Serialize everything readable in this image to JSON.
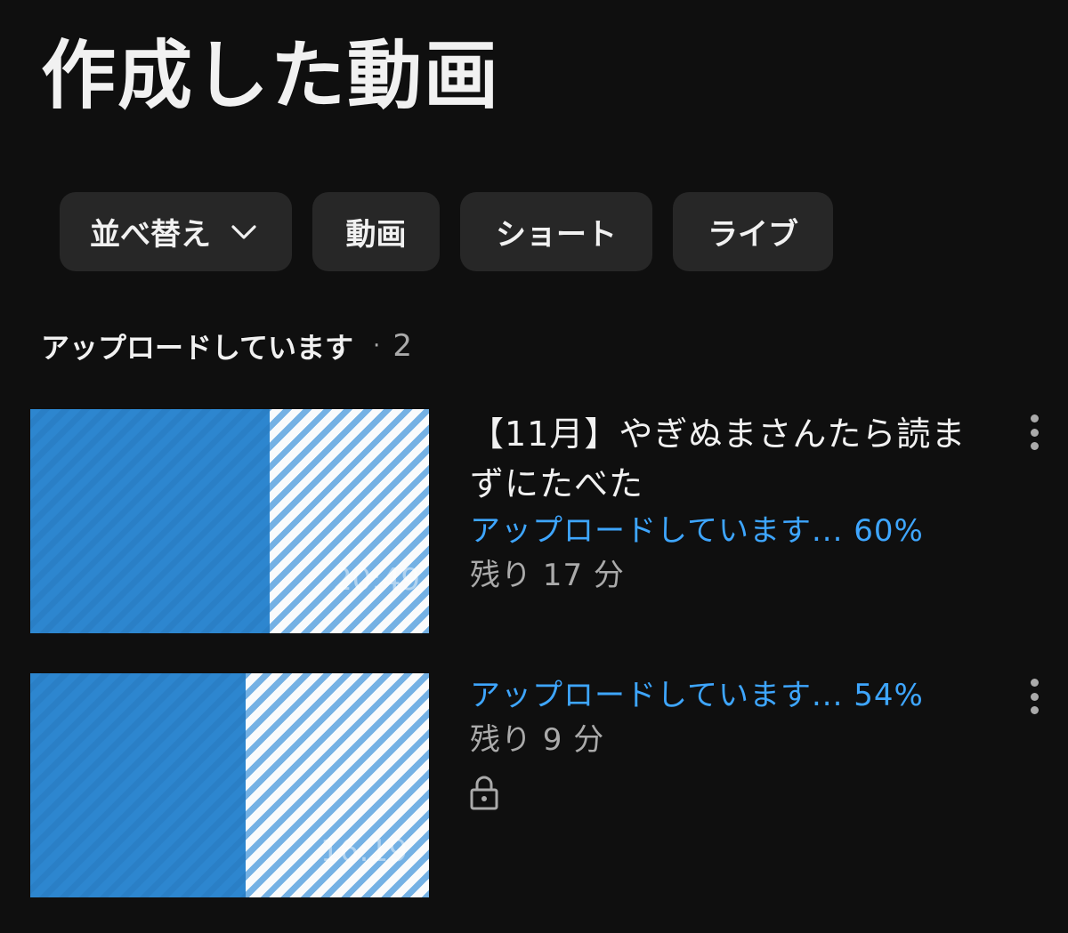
{
  "page": {
    "title": "作成した動画"
  },
  "chips": {
    "sort_label": "並べ替え",
    "videos_label": "動画",
    "shorts_label": "ショート",
    "live_label": "ライブ"
  },
  "section": {
    "label": "アップロードしています",
    "separator": "·",
    "count": "2"
  },
  "uploads": [
    {
      "title": "【11月】やぎぬまさんたら読まずにたべた",
      "status": "アップロードしています... 60%",
      "remaining": "残り 17 分",
      "progress": 0.6,
      "duration": "20:49",
      "private": false
    },
    {
      "title": "",
      "status": "アップロードしています... 54%",
      "remaining": "残り 9 分",
      "progress": 0.54,
      "duration": "16:19",
      "private": true
    }
  ],
  "icons": {
    "sort_chevron": "chevron-down-icon",
    "menu": "more-vert-icon",
    "privacy": "lock-icon"
  },
  "colors": {
    "background": "#0f0f0f",
    "chip": "#272727",
    "accent": "#3ea6ff",
    "secondary": "#aaaaaa",
    "progress_fill": "#2d86cf"
  }
}
